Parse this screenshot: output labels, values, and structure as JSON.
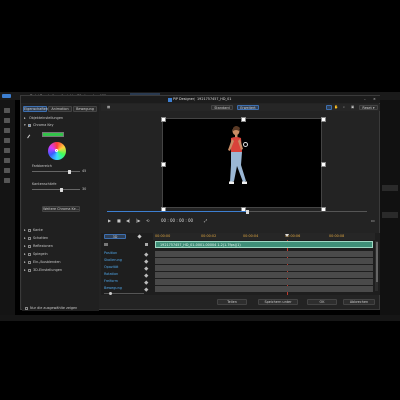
{
  "host": {
    "menu": [
      "Datei",
      "Bearbeiten",
      "Ansicht",
      "Wiedergabe",
      "Hilfe"
    ]
  },
  "dialog": {
    "title_prefix": "PiP Designer",
    "title_file": "1921757457_HD_01",
    "tabs": [
      "Eigenschaften",
      "Animation",
      "Bewegung"
    ],
    "view_buttons": [
      "Standard",
      "Erweitert"
    ],
    "preset_label": "Reset"
  },
  "props": {
    "sections_top": [
      "Objekteinstellungen",
      "Chroma Key"
    ],
    "chroma_color": "#33c24a",
    "slider1_label": "Farbbereich",
    "slider1_value": "45",
    "slider2_label": "Kantenschärfe",
    "slider2_value": "30",
    "apply_button": "Weitere Chroma Ke...",
    "sections_bottom": [
      "Kante",
      "Schatten",
      "Reflexionen",
      "Spiegeln",
      "Ein-/Ausblenden",
      "3D-Einstellungen"
    ],
    "footer_checkbox": "Nur die ausgewählte zeigen"
  },
  "transport": {
    "timecode": "00 : 00 : 00 : 00"
  },
  "timeline": {
    "toggle_left": "3D",
    "ruler_ticks": [
      "00:00:00",
      "00:00:02",
      "00:00:04",
      "00:00:06",
      "00:00:08"
    ],
    "clip_label": "1921757457_HD_01-0001-00004 1.2(1.7fps)(1)",
    "rows": [
      "Position",
      "Skalierung",
      "Opazität",
      "Rotation",
      "Freiform",
      "Bewegung"
    ]
  },
  "footer_buttons": [
    "Teilen",
    "Speichern unter",
    "OK",
    "Abbrechen"
  ],
  "colors": {
    "accent": "#3d7fd1",
    "clip": "#3f8f78",
    "playhead": "#c0392b"
  }
}
